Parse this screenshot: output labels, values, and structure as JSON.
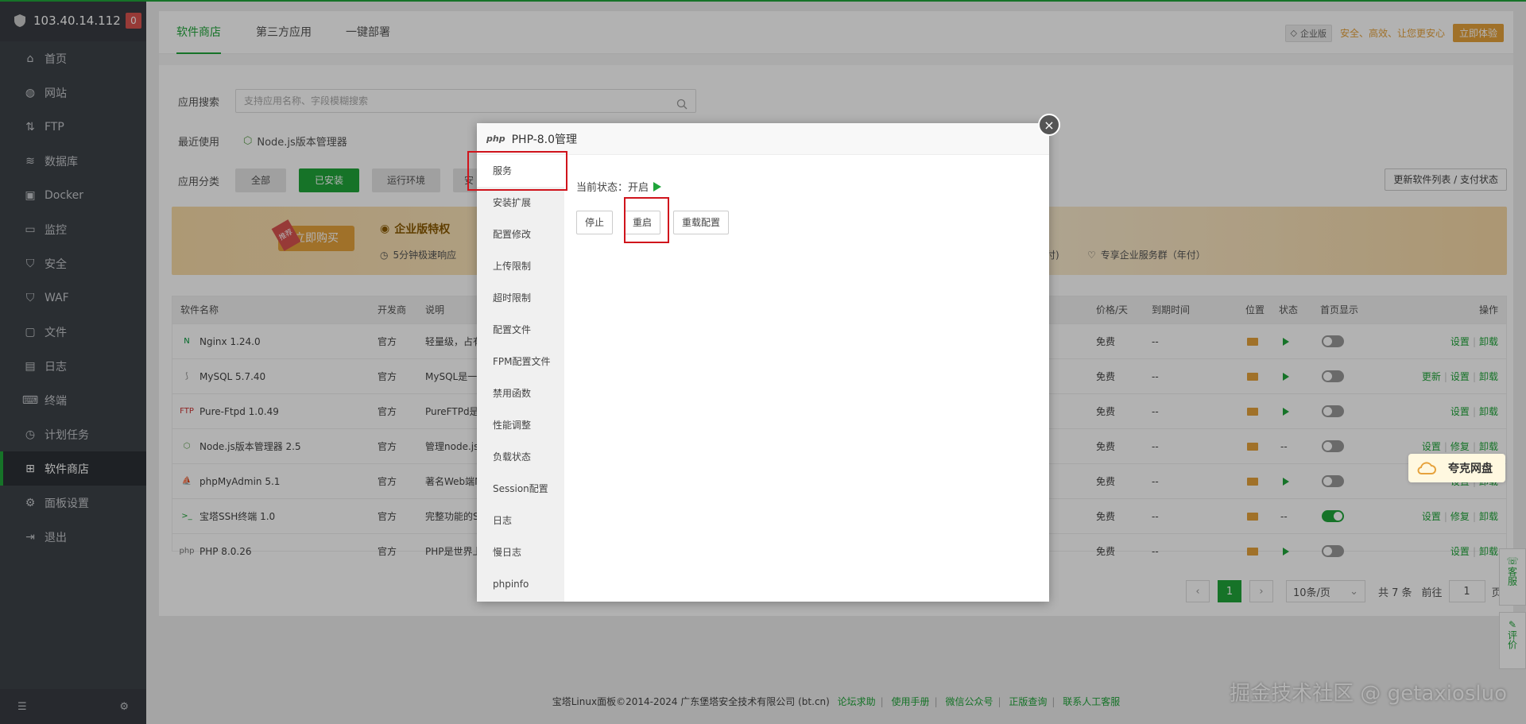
{
  "server": {
    "ip": "103.40.14.112",
    "badge": "0"
  },
  "nav": [
    {
      "label": "首页",
      "icon": "home-icon"
    },
    {
      "label": "网站",
      "icon": "globe-icon"
    },
    {
      "label": "FTP",
      "icon": "ftp-icon"
    },
    {
      "label": "数据库",
      "icon": "database-icon"
    },
    {
      "label": "Docker",
      "icon": "docker-icon"
    },
    {
      "label": "监控",
      "icon": "monitor-icon"
    },
    {
      "label": "安全",
      "icon": "shield-icon"
    },
    {
      "label": "WAF",
      "icon": "waf-icon"
    },
    {
      "label": "文件",
      "icon": "folder-icon"
    },
    {
      "label": "日志",
      "icon": "log-icon"
    },
    {
      "label": "终端",
      "icon": "terminal-icon"
    },
    {
      "label": "计划任务",
      "icon": "clock-icon"
    },
    {
      "label": "软件商店",
      "icon": "grid-icon",
      "active": true
    },
    {
      "label": "面板设置",
      "icon": "gear-icon"
    },
    {
      "label": "退出",
      "icon": "exit-icon"
    }
  ],
  "tabs": [
    "软件商店",
    "第三方应用",
    "一键部署"
  ],
  "vip": {
    "badge": "企业版",
    "text": "安全、高效、让您更安心",
    "button": "立即体验"
  },
  "search": {
    "label": "应用搜索",
    "placeholder": "支持应用名称、字段模糊搜索"
  },
  "recent": {
    "label": "最近使用",
    "item": "Node.js版本管理器"
  },
  "categories": {
    "label": "应用分类",
    "items": [
      "全部",
      "已安装",
      "运行环境",
      "安"
    ]
  },
  "update_button": "更新软件列表 / 支付状态",
  "banner": {
    "buy": "立即购买",
    "tag": "推荐",
    "title": "企业版特权",
    "feature1": "5分钟极速响应",
    "feature2": "付)",
    "feature3": "专享企业服务群（年付）"
  },
  "table": {
    "headers": [
      "软件名称",
      "开发商",
      "说明",
      "价格/天",
      "到期时间",
      "位置",
      "状态",
      "首页显示",
      "操作"
    ],
    "rows": [
      {
        "name": "Nginx 1.24.0",
        "icon": "nginx-icon",
        "dev": "官方",
        "desc": "轻量级，占有",
        "price": "免费",
        "expire": "--",
        "status": "running",
        "home": false,
        "ops": [
          "设置",
          "卸载"
        ]
      },
      {
        "name": "MySQL 5.7.40",
        "icon": "mysql-icon",
        "dev": "官方",
        "desc": "MySQL是一",
        "price": "免费",
        "expire": "--",
        "status": "running",
        "home": false,
        "ops": [
          "更新",
          "设置",
          "卸载"
        ]
      },
      {
        "name": "Pure-Ftpd 1.0.49",
        "icon": "ftp-logo-icon",
        "dev": "官方",
        "desc": "PureFTPd是",
        "price": "免费",
        "expire": "--",
        "status": "running",
        "home": false,
        "ops": [
          "设置",
          "卸载"
        ]
      },
      {
        "name": "Node.js版本管理器 2.5",
        "icon": "nodejs-icon",
        "dev": "官方",
        "desc": "管理node.js",
        "price": "免费",
        "expire": "--",
        "status": "--",
        "home": false,
        "ops": [
          "设置",
          "修复",
          "卸载"
        ]
      },
      {
        "name": "phpMyAdmin 5.1",
        "icon": "phpmyadmin-icon",
        "dev": "官方",
        "desc": "著名Web端M",
        "price": "免费",
        "expire": "--",
        "status": "running",
        "home": false,
        "ops": [
          "设置",
          "卸载"
        ]
      },
      {
        "name": "宝塔SSH终端 1.0",
        "icon": "ssh-terminal-icon",
        "dev": "官方",
        "desc": "完整功能的S",
        "price": "免费",
        "expire": "--",
        "status": "--",
        "home": true,
        "ops": [
          "设置",
          "修复",
          "卸载"
        ]
      },
      {
        "name": "PHP 8.0.26",
        "icon": "php-icon",
        "dev": "官方",
        "desc": "PHP是世界上",
        "price": "免费",
        "expire": "--",
        "status": "running",
        "home": false,
        "ops": [
          "设置",
          "卸载"
        ]
      }
    ]
  },
  "pager": {
    "current": "1",
    "per_page": "10条/页",
    "total": "共 7 条",
    "goto": "前往",
    "page_value": "1",
    "page_unit": "页"
  },
  "footer": {
    "copyright": "宝塔Linux面板©2014-2024 广东堡塔安全技术有限公司 (bt.cn)",
    "links": [
      "论坛求助",
      "使用手册",
      "微信公众号",
      "正版查询",
      "联系人工客服"
    ]
  },
  "watermark": "掘金技术社区 @ getaxiosluo",
  "modal": {
    "logo": "php",
    "title": "PHP-8.0管理",
    "menu": [
      "服务",
      "安装扩展",
      "配置修改",
      "上传限制",
      "超时限制",
      "配置文件",
      "FPM配置文件",
      "禁用函数",
      "性能调整",
      "负载状态",
      "Session配置",
      "日志",
      "慢日志",
      "phpinfo"
    ],
    "status_label": "当前状态：",
    "status_value": "开启",
    "buttons": [
      "停止",
      "重启",
      "重载配置"
    ],
    "close": "×"
  },
  "quark": "夸克网盘",
  "side": {
    "service": "客服",
    "review": "评价"
  },
  "colors": {
    "accent": "#20a53a",
    "highlight": "#d0141c",
    "gold": "#e6a23c"
  }
}
